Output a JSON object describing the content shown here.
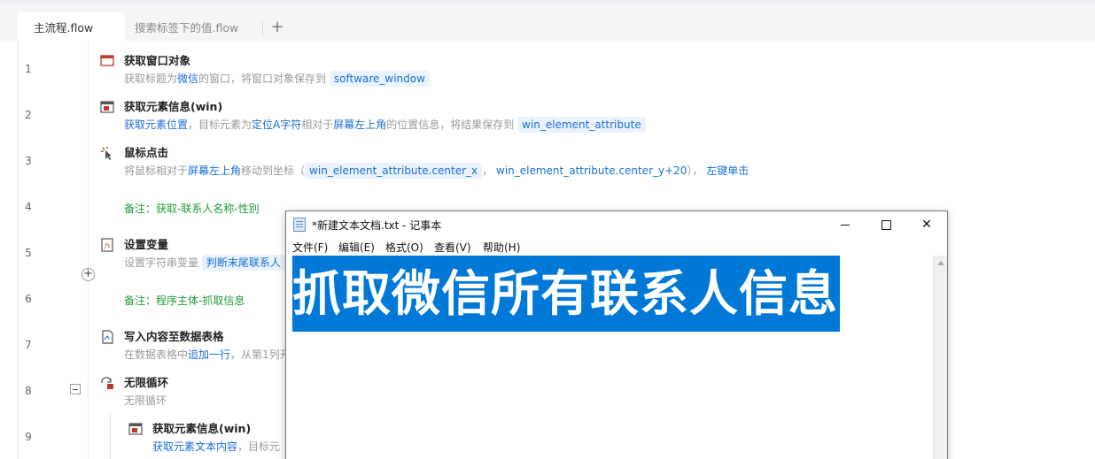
{
  "tabs": [
    {
      "label": "主流程.flow"
    },
    {
      "label": "搜索标签下的值.flow"
    }
  ],
  "tab_add_label": "+",
  "lines": [
    {
      "number": "1"
    },
    {
      "number": "2"
    },
    {
      "number": "3"
    },
    {
      "number": "4"
    },
    {
      "number": "5"
    },
    {
      "number": "6"
    },
    {
      "number": "7"
    },
    {
      "number": "8"
    },
    {
      "number": "9"
    }
  ],
  "steps": {
    "s1": {
      "title": "获取窗口对象",
      "d1": "获取标题为",
      "d2": "微信",
      "d3": "的窗口，将窗口对象保存到",
      "chip": "software_window"
    },
    "s2": {
      "title": "获取元素信息(win)",
      "d1": "获取元素位置",
      "d2": "，目标元素为",
      "d3": "定位A字符",
      "d4": "相对于",
      "d5": "屏幕左上角",
      "d6": "的位置信息，将结果保存到",
      "chip": "win_element_attribute"
    },
    "s3": {
      "title": "鼠标点击",
      "d1": "将鼠标相对于",
      "d2": "屏幕左上角",
      "d3": "移动到坐标（",
      "chip1": "win_element_attribute.center_x",
      "d4": "，",
      "d5": "win_element_attribute.center_y+20",
      "d6": "），",
      "d7": "左键单击"
    },
    "s4": {
      "comment": "备注：获取-联系人名称-性别"
    },
    "s5": {
      "title": "设置变量",
      "d1": "设置字符串变量",
      "chip": "判断末尾联系人"
    },
    "s6": {
      "comment": "备注：程序主体-抓取信息"
    },
    "s7": {
      "title": "写入内容至数据表格",
      "d1": "在数据表格中",
      "d2": "追加一行",
      "d3": "，从第1列开"
    },
    "s8": {
      "title": "无限循环",
      "d1": "无限循环"
    },
    "s9": {
      "title": "获取元素信息(win)",
      "d1": "获取元素文本内容",
      "d2": "，目标元"
    }
  },
  "notepad": {
    "title": "*新建文本文档.txt - 记事本",
    "menus": [
      "文件(F)",
      "编辑(E)",
      "格式(O)",
      "查看(V)",
      "帮助(H)"
    ],
    "content": "抓取微信所有联系人信息",
    "close_glyph": "✕"
  },
  "colors": {
    "accent": "#1a6fd6",
    "comment": "#1e9c3a",
    "selection": "#0078d7"
  }
}
